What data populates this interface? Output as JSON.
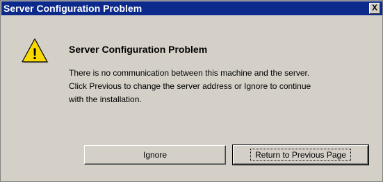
{
  "window": {
    "title": "Server Configuration Problem",
    "close_glyph": "X",
    "titlebar_color": "#0b2a8c",
    "background_color": "#d4d0c8"
  },
  "icon": {
    "name": "warning-icon",
    "glyph": "!",
    "color": "#f8d800"
  },
  "content": {
    "heading": "Server Configuration Problem",
    "message_lines": [
      "There is no communication between this machine and the server.",
      "Click Previous to change the server address or Ignore to continue",
      "with the installation."
    ]
  },
  "buttons": {
    "ignore_label": "Ignore",
    "return_label": "Return to Previous Page"
  }
}
